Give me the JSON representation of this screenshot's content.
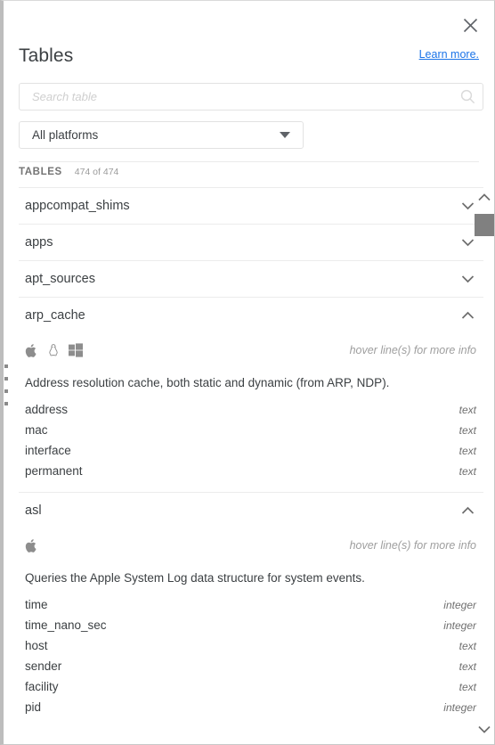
{
  "header": {
    "title": "Tables",
    "learn_more": "Learn more.",
    "close_icon": "close-icon"
  },
  "search": {
    "placeholder": "Search table",
    "value": "",
    "icon": "search-icon"
  },
  "platform_filter": {
    "selected": "All platforms",
    "caret_icon": "chevron-down-icon"
  },
  "section": {
    "label": "TABLES",
    "count": "474 of 474"
  },
  "colors": {
    "link": "#1a73e8",
    "text": "#3c4043",
    "muted": "#9e9e9e",
    "divider": "#ececec",
    "scrollbar_thumb": "#808080",
    "handle": "#8a8a8a"
  },
  "scrollbar": {
    "up_icon": "chevron-up-icon",
    "down_icon": "chevron-down-icon",
    "thumb": "scrollbar-thumb"
  },
  "tables": [
    {
      "name": "appcompat_shims",
      "expanded": false,
      "chevron": "chevron-down-icon"
    },
    {
      "name": "apps",
      "expanded": false,
      "chevron": "chevron-down-icon"
    },
    {
      "name": "apt_sources",
      "expanded": false,
      "chevron": "chevron-down-icon"
    },
    {
      "name": "arp_cache",
      "expanded": true,
      "chevron": "chevron-up-icon",
      "platforms": [
        "apple-icon",
        "linux-icon",
        "windows-icon"
      ],
      "hover_note": "hover line(s) for more info",
      "description": "Address resolution cache, both static and dynamic (from ARP, NDP).",
      "columns": [
        {
          "name": "address",
          "type": "text"
        },
        {
          "name": "mac",
          "type": "text"
        },
        {
          "name": "interface",
          "type": "text"
        },
        {
          "name": "permanent",
          "type": "text"
        }
      ]
    },
    {
      "name": "asl",
      "expanded": true,
      "chevron": "chevron-up-icon",
      "platforms": [
        "apple-icon"
      ],
      "hover_note": "hover line(s) for more info",
      "description": "Queries the Apple System Log data structure for system events.",
      "columns": [
        {
          "name": "time",
          "type": "integer"
        },
        {
          "name": "time_nano_sec",
          "type": "integer"
        },
        {
          "name": "host",
          "type": "text"
        },
        {
          "name": "sender",
          "type": "text"
        },
        {
          "name": "facility",
          "type": "text"
        },
        {
          "name": "pid",
          "type": "integer"
        }
      ]
    }
  ]
}
